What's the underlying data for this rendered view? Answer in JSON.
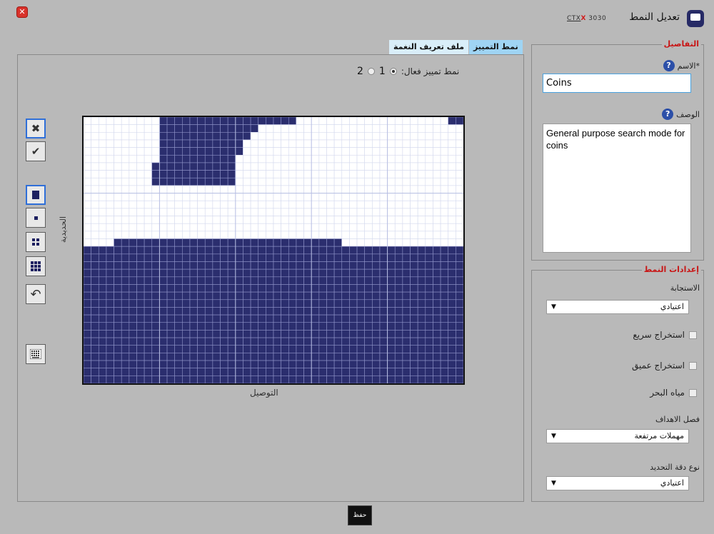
{
  "window": {
    "title": "تعديل النمط",
    "brand": {
      "ctx": "CTX",
      "model": "3030"
    }
  },
  "tabs": [
    {
      "label": "نمط التمييز",
      "active": true
    },
    {
      "label": "ملف تعريف النغمة",
      "active": false
    }
  ],
  "main": {
    "active_pattern_label": "نمط تمييز فعال:",
    "pattern_options": [
      "1",
      "2"
    ],
    "selected_pattern": "1",
    "y_axis_label": "الحديدية",
    "x_axis_label": "التوصيل"
  },
  "tools": [
    {
      "icon": "cross-icon",
      "glyph": "✖"
    },
    {
      "icon": "check-icon",
      "glyph": "✔"
    },
    {
      "icon": "brush-select-icon",
      "glyph": "▪"
    },
    {
      "icon": "small-brush-icon",
      "glyph": "▪"
    },
    {
      "icon": "medium-brush-icon",
      "glyph": "▦"
    },
    {
      "icon": "large-brush-icon",
      "glyph": "▦"
    },
    {
      "icon": "undo-icon",
      "glyph": "↶"
    },
    {
      "icon": "keyboard-icon",
      "glyph": "▦"
    }
  ],
  "grid": {
    "cols": 50,
    "rows": 35,
    "fill_color": "#2b2e6e",
    "bottom_fill_start_row": 17,
    "blocks": [
      {
        "row": 0,
        "c0": 10,
        "c1": 27
      },
      {
        "row": 0,
        "c0": 48,
        "c1": 49
      },
      {
        "row": 1,
        "c0": 10,
        "c1": 22
      },
      {
        "row": 2,
        "c0": 10,
        "c1": 21
      },
      {
        "row": 3,
        "c0": 10,
        "c1": 20
      },
      {
        "row": 4,
        "c0": 10,
        "c1": 20
      },
      {
        "row": 5,
        "c0": 10,
        "c1": 19
      },
      {
        "row": 6,
        "c0": 9,
        "c1": 19
      },
      {
        "row": 7,
        "c0": 9,
        "c1": 19
      },
      {
        "row": 8,
        "c0": 9,
        "c1": 19
      },
      {
        "row": 16,
        "c0": 4,
        "c1": 33
      }
    ]
  },
  "save_label": "حفظ",
  "details": {
    "legend": "التفاصيل",
    "name_label": "*الاسم",
    "name_value": "Coins",
    "description_label": "الوصف",
    "description_value": "General purpose search mode for coins"
  },
  "settings": {
    "legend": "إعدادات النمط",
    "response_label": "الاستجابة",
    "response_value": "اعتيادي",
    "fast_extraction_label": "استخراج سريع",
    "deep_extraction_label": "استخراج عميق",
    "seawater_label": "مياه البحر",
    "target_separation_label": "فصل الاهداف",
    "target_separation_value": "مهملات مرتفعة",
    "accuracy_type_label": "نوع دقة التحديد",
    "accuracy_type_value": "اعتيادي"
  },
  "colors": {
    "accent": "#2f6fd8",
    "legend": "#c81515",
    "tab_active": "#9fd4f4",
    "tab_inactive": "#d9eef9",
    "background": "#b9b9b9"
  }
}
